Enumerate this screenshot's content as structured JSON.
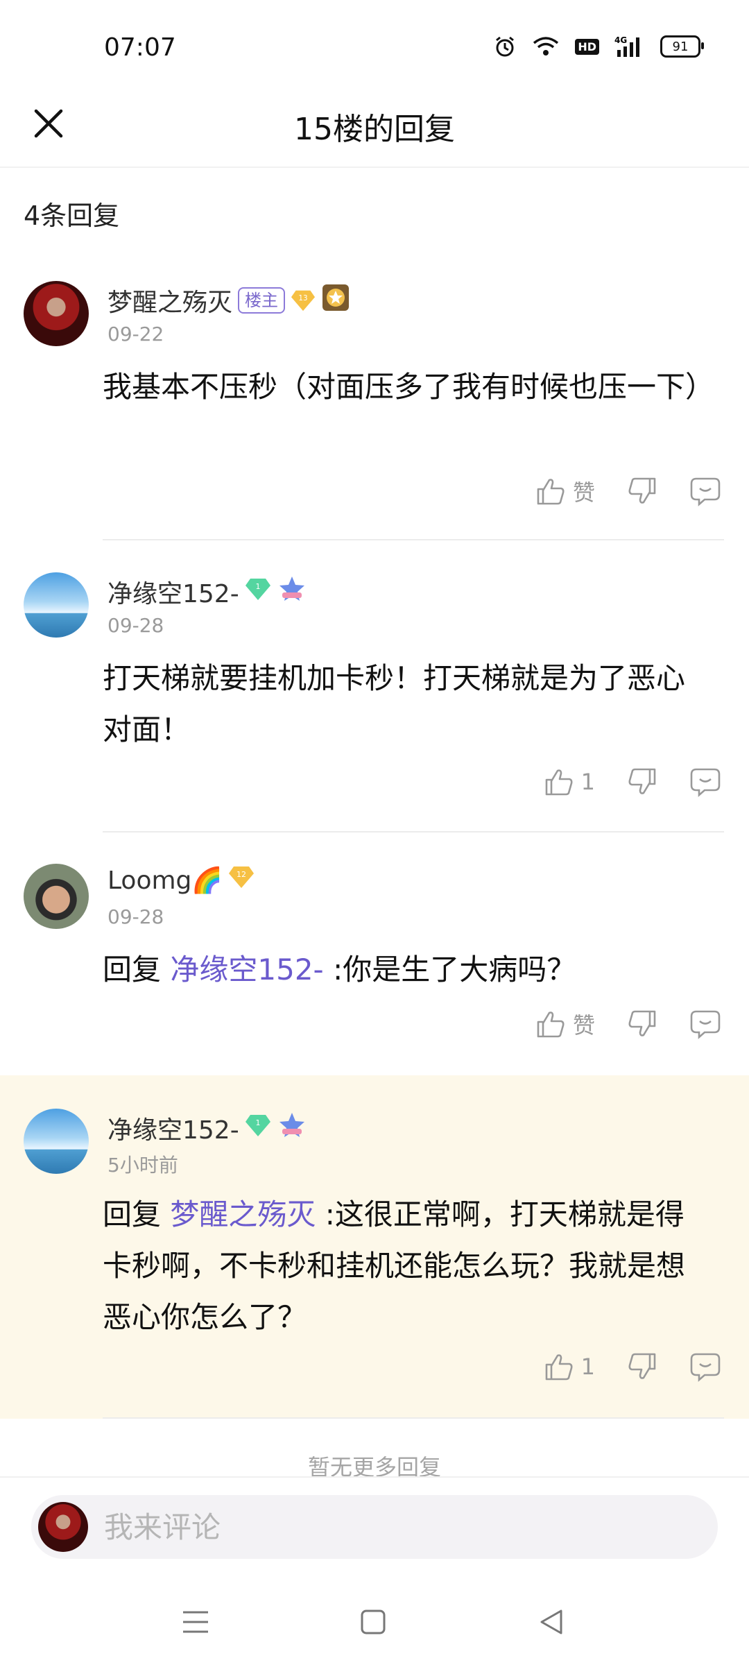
{
  "status_bar": {
    "time": "07:07",
    "icons": [
      "alarm-icon",
      "wifi-icon",
      "hd-icon",
      "signal-4g-icon",
      "battery-icon"
    ],
    "hd_label": "HD",
    "network_label": "4G",
    "battery_level": "91"
  },
  "header": {
    "title": "15楼的回复",
    "close_icon": "close-icon"
  },
  "reply_count": "4条回复",
  "comments": [
    {
      "username": "梦醒之殇灭",
      "owner_tag": "楼主",
      "level": "13",
      "date": "09-22",
      "text": "我基本不压秒（对面压多了我有时候也压一下）",
      "like_label": "赞"
    },
    {
      "username": "净缘空152-",
      "level": "1",
      "date": "09-28",
      "text": "打天梯就要挂机加卡秒！打天梯就是为了恶心对面！",
      "like_label": "1"
    },
    {
      "username": "Loomg🌈",
      "level": "12",
      "date": "09-28",
      "reply_prefix": "回复",
      "mention": "净缘空152-",
      "text": ":你是生了大病吗？",
      "like_label": "赞"
    },
    {
      "username": "净缘空152-",
      "level": "1",
      "date": "5小时前",
      "reply_prefix": "回复",
      "mention": "梦醒之殇灭",
      "text": ":这很正常啊，打天梯就是得卡秒啊，不卡秒和挂机还能怎么玩？我就是想恶心你怎么了？",
      "like_label": "1"
    }
  ],
  "no_more_text": "暂无更多回复",
  "comment_input": {
    "placeholder": "我来评论"
  },
  "colors": {
    "mention": "#6a5acd",
    "highlight_bg": "#fdf8e9",
    "owner_tag": "#7a68cc"
  }
}
